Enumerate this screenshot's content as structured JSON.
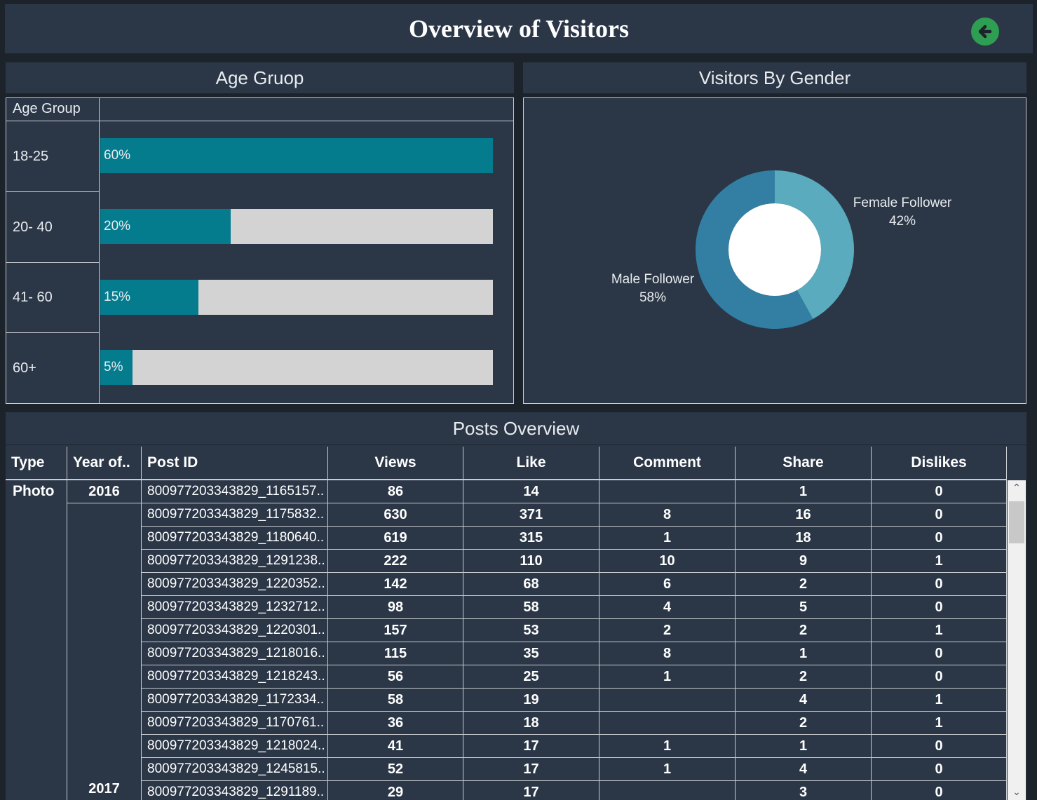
{
  "header": {
    "title": "Overview of Visitors",
    "back_icon": "arrow-left-icon"
  },
  "age_panel": {
    "title": "Age Gruop",
    "column_header": "Age Group",
    "rows": [
      {
        "label": "18-25",
        "percent_label": "60%",
        "fill": 1.0
      },
      {
        "label": "20- 40",
        "percent_label": "20%",
        "fill": 0.333
      },
      {
        "label": "41- 60",
        "percent_label": "15%",
        "fill": 0.25
      },
      {
        "label": "60+",
        "percent_label": "5%",
        "fill": 0.083
      }
    ]
  },
  "gender_panel": {
    "title": "Visitors By Gender",
    "slices": [
      {
        "name": "Female Follower",
        "pct_label": "42%",
        "value": 42,
        "color": "#5aabbe"
      },
      {
        "name": "Male Follower",
        "pct_label": "58%",
        "value": 58,
        "color": "#327fa3"
      }
    ]
  },
  "posts": {
    "title": "Posts Overview",
    "columns": [
      "Type",
      "Year of..",
      "Post ID",
      "Views",
      "Like",
      "Comment",
      "Share",
      "Dislikes"
    ],
    "type": "Photo",
    "years": [
      "2016",
      "2017"
    ],
    "rows": [
      [
        "800977203343829_1165157..",
        "86",
        "14",
        "",
        "1",
        "0"
      ],
      [
        "800977203343829_1175832..",
        "630",
        "371",
        "8",
        "16",
        "0"
      ],
      [
        "800977203343829_1180640..",
        "619",
        "315",
        "1",
        "18",
        "0"
      ],
      [
        "800977203343829_1291238..",
        "222",
        "110",
        "10",
        "9",
        "1"
      ],
      [
        "800977203343829_1220352..",
        "142",
        "68",
        "6",
        "2",
        "0"
      ],
      [
        "800977203343829_1232712..",
        "98",
        "58",
        "4",
        "5",
        "0"
      ],
      [
        "800977203343829_1220301..",
        "157",
        "53",
        "2",
        "2",
        "1"
      ],
      [
        "800977203343829_1218016..",
        "115",
        "35",
        "8",
        "1",
        "0"
      ],
      [
        "800977203343829_1218243..",
        "56",
        "25",
        "1",
        "2",
        "0"
      ],
      [
        "800977203343829_1172334..",
        "58",
        "19",
        "",
        "4",
        "1"
      ],
      [
        "800977203343829_1170761..",
        "36",
        "18",
        "",
        "2",
        "1"
      ],
      [
        "800977203343829_1218024..",
        "41",
        "17",
        "1",
        "1",
        "0"
      ],
      [
        "800977203343829_1245815..",
        "52",
        "17",
        "1",
        "4",
        "0"
      ],
      [
        "800977203343829_1291189..",
        "29",
        "17",
        "",
        "3",
        "0"
      ]
    ]
  },
  "colors": {
    "bg": "#1d232b",
    "panel": "#2b3747",
    "bar_fill": "#047c8d",
    "bar_track": "#d3d3d3",
    "back_button": "#2e9e52"
  }
}
